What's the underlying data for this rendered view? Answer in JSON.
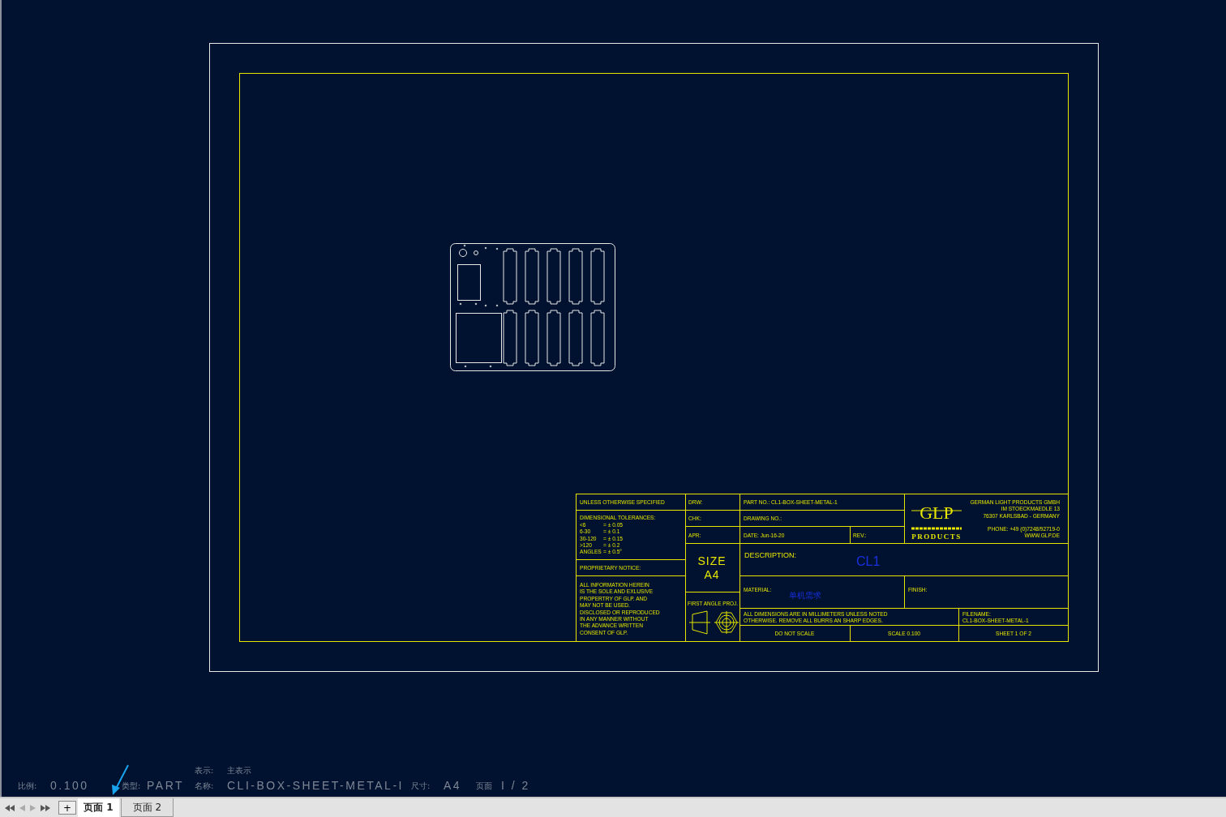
{
  "title_block": {
    "general_note": "UNLESS OTHERWISE SPECIFIED",
    "tolerances_heading": "DIMENSIONAL TOLERANCES:",
    "tolerances": [
      {
        "range": "<6",
        "value": "= ± 0.05"
      },
      {
        "range": "6-30",
        "value": "= ± 0.1"
      },
      {
        "range": "30-120",
        "value": "= ± 0.15"
      },
      {
        "range": ">120",
        "value": "= ± 0.2"
      },
      {
        "range": "ANGLES",
        "value": "= ± 0.5°"
      }
    ],
    "proprietary_heading": "PROPRIETARY NOTICE:",
    "proprietary_text": [
      "ALL INFORMATION HEREIN",
      "IS THE SOLE AND EXLUSIVE",
      "PROPERTRY OF GLP. AND",
      "MAY NOT BE USED.",
      "DISCLOSED OR REPRODUCED",
      "IN ANY MANNER WITHOUT",
      "THE ADVANCE WRITTEN",
      "CONSENT OF GLP."
    ],
    "drw": "DRW:",
    "chk": "CHK:",
    "apr": "APR:",
    "size_label": "SIZE",
    "size": "A4",
    "projection": "FIRST ANGLE PROJ.",
    "part_no": "PART NO.:  CL1-BOX-SHEET-METAL-1",
    "drawing_no": "DRAWING NO.:",
    "date": "DATE:  Jun-16-20",
    "rev": "REV.:",
    "logo": {
      "mark": "GLP",
      "word": "PRODUCTS"
    },
    "company": [
      "GERMAN LIGHT PRODUCTS GMBH",
      "IM STOECKMAEDLE 13",
      "76307 KARLSBAD - GERMANY"
    ],
    "contact": [
      "PHONE:  +49 (0)7248/92719-0",
      "WWW.GLP.DE"
    ],
    "description_label": "DESCRIPTION:",
    "description": "CL1",
    "material_label": "MATERIAL:",
    "material": "单机需求",
    "finish_label": "FINISH:",
    "notes": [
      "ALL DIMENSIONS ARE IN MILLIMETERS UNLESS NOTED",
      "OTHERWISE. REMOVE ALL BURRS AN SHARP EDGES."
    ],
    "filename_label": "FILENAME:",
    "filename": "CL1-BOX-SHEET-METAL-1",
    "no_scale": "DO NOT SCALE",
    "scale": "SCALE 0.100",
    "sheet": "SHEET 1 OF 2"
  },
  "status": {
    "representation": {
      "label": "表示:",
      "value": "主表示"
    },
    "items": [
      {
        "label": "比例:",
        "value": "0.100"
      },
      {
        "label": "类型:",
        "value": "PART"
      },
      {
        "label": "名称:",
        "value": "CLI-BOX-SHEET-METAL-I"
      },
      {
        "label": "尺寸:",
        "value": "A4"
      },
      {
        "label": "页面",
        "value": "I / 2"
      }
    ]
  },
  "add_tab_button": "+",
  "page_tabs": [
    {
      "label": "页面 1",
      "selected": true
    },
    {
      "label": "页面 2",
      "selected": false
    }
  ]
}
